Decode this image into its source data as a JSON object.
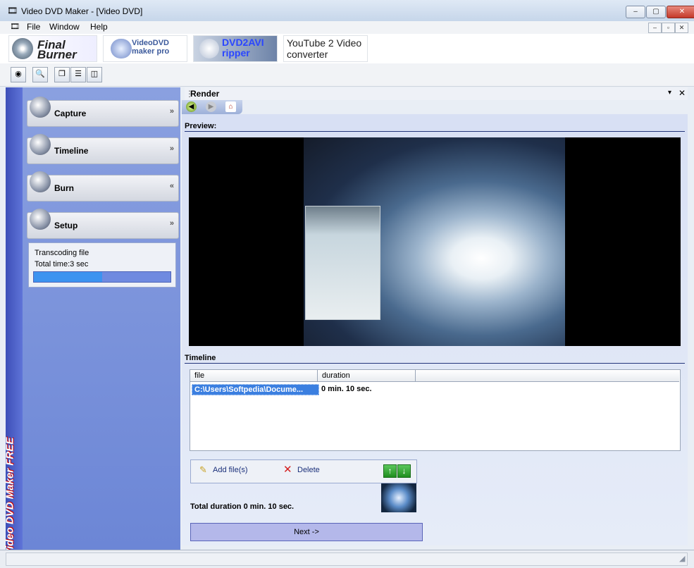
{
  "window": {
    "title": "Video DVD Maker - [Video DVD]",
    "minimize": "–",
    "maximize": "▢",
    "close": "✕"
  },
  "menu": {
    "items": [
      "File",
      "Window",
      "Help"
    ],
    "mdi": [
      "–",
      "▫",
      "✕"
    ]
  },
  "logos": {
    "final_burner": "Final Burner",
    "videodvd_maker_pro": "VideoDVD maker pro",
    "dvd2avi": "DVD2AVI ripper",
    "youtube2video": "YouTube 2 Video converter"
  },
  "toolbar": {
    "icons": [
      "dvd-icon",
      "open-project-icon",
      "cascade-icon",
      "tile-horizontal-icon",
      "tile-vertical-icon"
    ]
  },
  "sidebar": {
    "brand": "Video DVD Maker FREE",
    "sections": [
      {
        "label": "Capture",
        "icon": "camcorder-icon",
        "chevron": "»"
      },
      {
        "label": "Timeline",
        "icon": "film-reel-icon",
        "chevron": "»"
      },
      {
        "label": "Burn",
        "icon": "dvd-disc-icon",
        "chevron": "«"
      },
      {
        "label": "Setup",
        "icon": "gear-icon",
        "chevron": "»"
      }
    ],
    "status": {
      "line1": "Transcoding file",
      "line2": "Total time:3 sec",
      "progress": 0.5
    }
  },
  "render": {
    "title": "Render",
    "preview_label": "Preview:",
    "timeline_label": "Timeline",
    "columns": [
      "file",
      "duration"
    ],
    "rows": [
      {
        "file": "C:\\Users\\Softpedia\\Docume...",
        "duration": "0 min. 10 sec."
      }
    ],
    "add_files": "Add file(s)",
    "delete": "Delete",
    "total_duration": "Total duration 0 min. 10 sec.",
    "next": "Next ->"
  },
  "colors": {
    "sidebar_brand_text": "#ffffff",
    "sidebar_accent": "#3d4fb8",
    "progress_fill": "#3c93f0"
  }
}
